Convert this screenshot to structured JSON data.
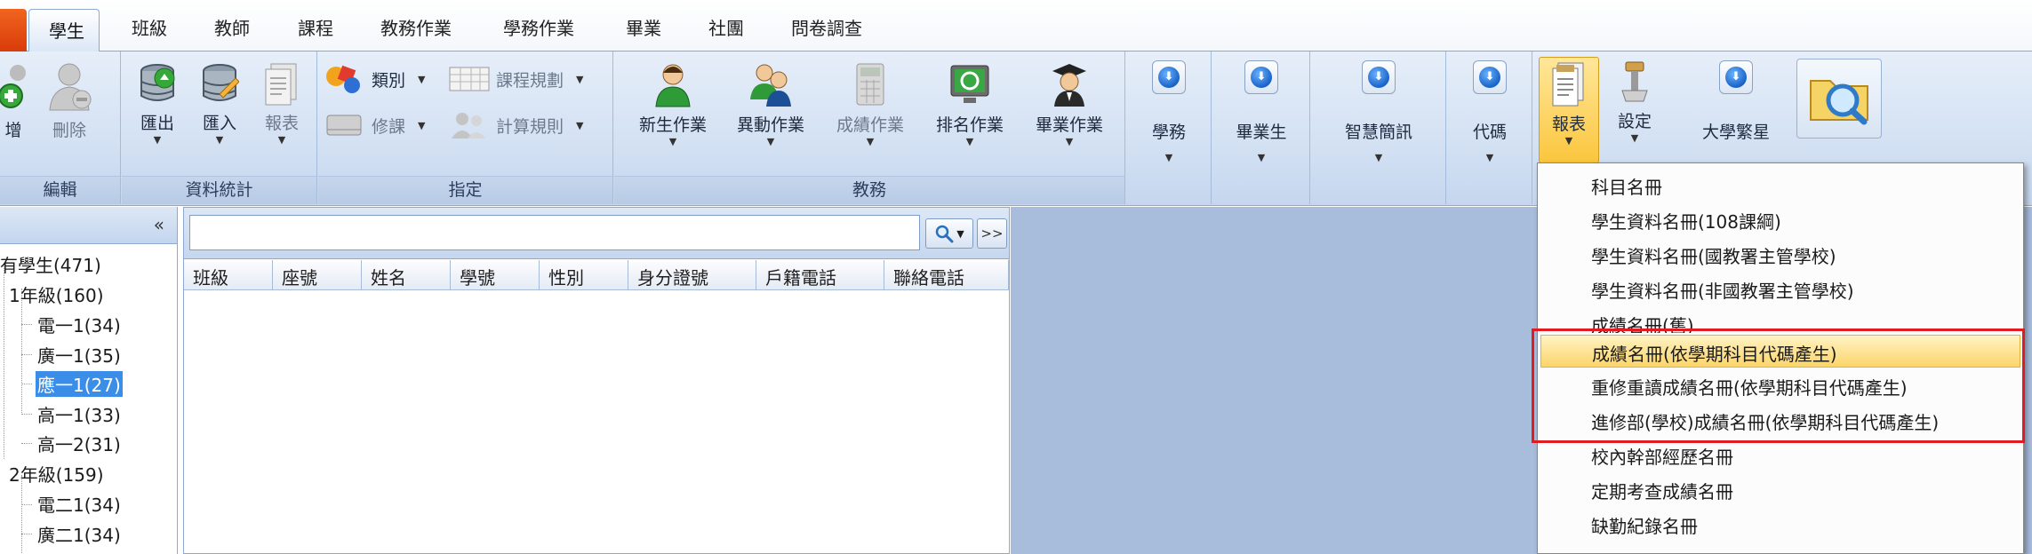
{
  "tabs": [
    "學生",
    "班級",
    "教師",
    "課程",
    "教務作業",
    "學務作業",
    "畢業",
    "社團",
    "問卷調查"
  ],
  "active_tab": "學生",
  "ribbon": {
    "groups": {
      "edit": "編輯",
      "data_stats": "資料統計",
      "assign": "指定",
      "academic": "教務"
    },
    "edit": {
      "add_partial": "增",
      "delete": "刪除"
    },
    "data_stats": {
      "export": "匯出",
      "import": "匯入",
      "report": "報表"
    },
    "assign": {
      "category": "類別",
      "course_plan": "課程規劃",
      "take_course": "修課",
      "calc_rule": "計算規則"
    },
    "academic": {
      "new_student": "新生作業",
      "transfer": "異動作業",
      "grade": "成績作業",
      "ranking": "排名作業",
      "graduation": "畢業作業"
    },
    "right_buttons": {
      "student_affairs": "學務",
      "graduate": "畢業生",
      "smart_brief": "智慧簡訊",
      "code": "代碼",
      "report": "報表",
      "settings": "設定",
      "university_star": "大學繁星"
    }
  },
  "tree": {
    "collapse": "«",
    "items": [
      "有學生(471)",
      "1年級(160)",
      "電一1(34)",
      "廣一1(35)",
      "應一1(27)",
      "高一1(33)",
      "高一2(31)",
      "2年級(159)",
      "電二1(34)",
      "廣二1(34)"
    ],
    "selected_index": 4
  },
  "list": {
    "search_value": "",
    "more_label": ">>",
    "columns": [
      "班級",
      "座號",
      "姓名",
      "學號",
      "性別",
      "身分證號",
      "戶籍電話",
      "聯絡電話"
    ]
  },
  "menu": {
    "items": [
      "科目名冊",
      "學生資料名冊(108課綱)",
      "學生資料名冊(國教署主管學校)",
      "學生資料名冊(非國教署主管學校)",
      "成績名冊(舊)",
      "成績名冊(依學期科目代碼產生)",
      "重修重讀成績名冊(依學期科目代碼產生)",
      "進修部(學校)成績名冊(依學期科目代碼產生)",
      "校內幹部經歷名冊",
      "定期考查成績名冊",
      "缺勤紀錄名冊"
    ],
    "highlighted_index": 5
  },
  "colors": {
    "ribbon_blue": "#d3e1f3",
    "selection_blue": "#3b8ee8",
    "highlight_gold": "#fbd56a",
    "annotation_red": "#e01c22",
    "workspace": "#a8bcdc"
  }
}
